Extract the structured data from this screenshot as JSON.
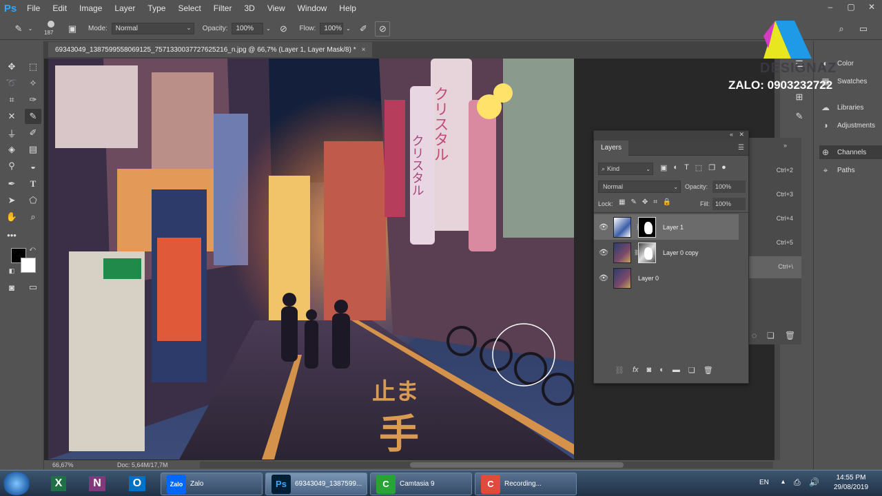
{
  "app": {
    "logo": "Ps",
    "menu": [
      "File",
      "Edit",
      "Image",
      "Layer",
      "Type",
      "Select",
      "Filter",
      "3D",
      "View",
      "Window",
      "Help"
    ],
    "window_controls": [
      "–",
      "▢",
      "✕"
    ]
  },
  "options": {
    "brush_size": "187",
    "mode_label": "Mode:",
    "mode_value": "Normal",
    "opacity_label": "Opacity:",
    "opacity_value": "100%",
    "flow_label": "Flow:",
    "flow_value": "100%"
  },
  "document": {
    "tab_title": "69343049_1387599558069125_7571330037727625216_n.jpg @ 66,7% (Layer 1, Layer Mask/8) *",
    "zoom": "66,67%",
    "doc_info": "Doc: 5,64M/17,7M"
  },
  "image_text": {
    "sign_vertical_1": "クリスタル",
    "sign_vertical_2": "クリスタル",
    "road_marking_1": "止ま",
    "road_marking_2": "手"
  },
  "watermark": {
    "brand": "DESIGNAZ",
    "contact": "ZALO: 0903232722"
  },
  "dock": {
    "items": [
      {
        "label": "Color",
        "icon": "color-icon"
      },
      {
        "label": "Swatches",
        "icon": "swatches-icon"
      },
      {
        "label": "Libraries",
        "icon": "libraries-icon"
      },
      {
        "label": "Adjustments",
        "icon": "adjustments-icon"
      },
      {
        "label": "Channels",
        "icon": "channels-icon"
      },
      {
        "label": "Paths",
        "icon": "paths-icon"
      }
    ],
    "shortcuts": [
      "Ctrl+2",
      "Ctrl+3",
      "Ctrl+4",
      "Ctrl+5",
      "Ctrl+\\"
    ]
  },
  "layers_panel": {
    "title": "Layers",
    "filter_kind": "Kind",
    "blend_mode": "Normal",
    "opacity_label": "Opacity:",
    "opacity_value": "100%",
    "lock_label": "Lock:",
    "fill_label": "Fill:",
    "fill_value": "100%",
    "layers": [
      {
        "name": "Layer 1",
        "has_mask": true,
        "selected": true
      },
      {
        "name": "Layer 0 copy",
        "has_mask": true,
        "selected": false
      },
      {
        "name": "Layer 0",
        "has_mask": false,
        "selected": false
      }
    ],
    "footer_icons": [
      "link-icon",
      "fx-icon",
      "add-mask-icon",
      "adjustment-layer-icon",
      "group-folder-icon",
      "new-layer-icon",
      "trash-icon"
    ]
  },
  "taskbar": {
    "pinned": [
      "Excel",
      "OneNote",
      "Outlook"
    ],
    "buttons": [
      {
        "label": "Zalo",
        "app": "Zalo",
        "color": "#0068ff"
      },
      {
        "label": "69343049_1387599...",
        "app": "Ps",
        "color": "#001e36"
      },
      {
        "label": "Camtasia 9",
        "app": "C",
        "color": "#2aa336"
      },
      {
        "label": "Recording...",
        "app": "C",
        "color": "#e04a3f"
      }
    ],
    "language": "EN",
    "time": "14:55 PM",
    "date": "29/08/2019"
  }
}
